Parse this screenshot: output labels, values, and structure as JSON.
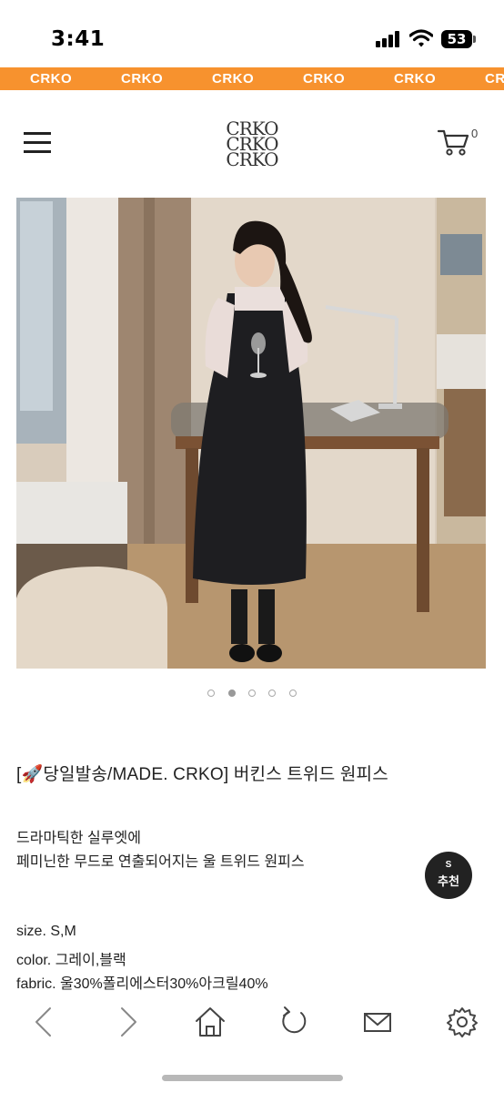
{
  "status_bar": {
    "time": "3:41",
    "battery": "53"
  },
  "marquee": {
    "text": "CRKO",
    "color": "#f7922e"
  },
  "header": {
    "logo_lines": [
      "CRKO",
      "CRKO",
      "CRKO"
    ],
    "cart_count": "0",
    "icons": {
      "menu": "menu-icon",
      "cart": "cart-icon"
    }
  },
  "carousel": {
    "total": 5,
    "active_index": 1
  },
  "product": {
    "title": "[🚀당일발송/MADE. CRKO] 버킨스 트위드 원피스",
    "description_lines": [
      "드라마틱한 실루엣에",
      "페미닌한 무드로 연출되어지는 울 트위드 원피스"
    ],
    "size": "size. S,M",
    "color": "color. 그레이,블랙",
    "fabric": "fabric. 울30%폴리에스터30%아크릴40%"
  },
  "recommend_badge": {
    "small": "S",
    "label": "추천"
  },
  "toolbar": {
    "icons": [
      "back-icon",
      "forward-icon",
      "home-icon",
      "refresh-icon",
      "mail-icon",
      "settings-icon"
    ]
  }
}
